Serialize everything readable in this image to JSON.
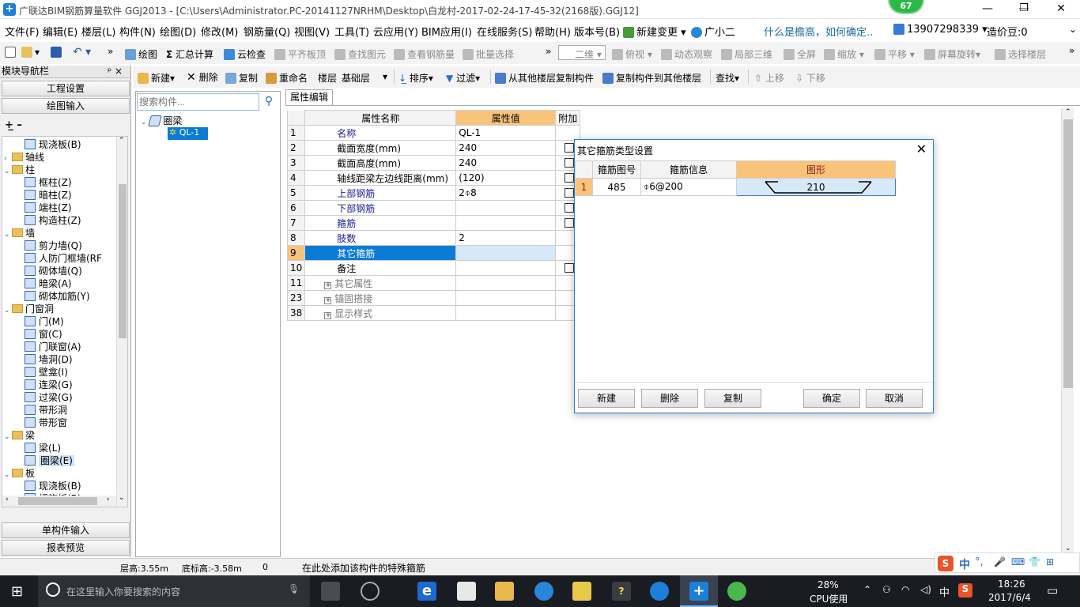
{
  "window": {
    "title": "广联达BIM钢筋算量软件 GGJ2013 - [C:\\Users\\Administrator.PC-20141127NRHM\\Desktop\\白龙村-2017-02-24-17-45-32(2168版).GGJ12]",
    "badge": "67",
    "minimize": "—",
    "maximize": "❐",
    "close": "✕"
  },
  "menu": [
    "文件(F)",
    "编辑(E)",
    "楼层(L)",
    "构件(N)",
    "绘图(D)",
    "修改(M)",
    "钢筋量(Q)",
    "视图(V)",
    "工具(T)",
    "云应用(Y)",
    "BIM应用(I)",
    "在线服务(S)",
    "帮助(H)",
    "版本号(B)",
    "新建变更 ▾",
    "广小二",
    "什么是檐高，如何确定..",
    "13907298339 ▾",
    "造价豆:0"
  ],
  "toolbar1": {
    "draw": "绘图",
    "sum": "汇总计算",
    "cloud_check": "云检查",
    "flush": "平齐板顶",
    "find": "查找图元",
    "view_rebar": "查看钢筋量",
    "batch": "批量选择",
    "view_mode": "二维",
    "top_view": "俯视",
    "dynamic": "动态观察",
    "local3d": "局部三维",
    "fullscreen": "全屏",
    "zoom": "缩放",
    "pan": "平移",
    "rotate": "屏幕旋转",
    "select_floor": "选择楼层"
  },
  "toolbar2": {
    "new": "新建",
    "delete": "删除",
    "copy": "复制",
    "rename": "重命名",
    "floor_label": "楼层",
    "floor_value": "基础层",
    "sort": "排序",
    "filter": "过滤",
    "copy_from": "从其他楼层复制构件",
    "copy_to": "复制构件到其他楼层",
    "find": "查找",
    "up": "上移",
    "down": "下移"
  },
  "nav": {
    "title": "模块导航栏",
    "pin": "ᵖ ×",
    "project_settings": "工程设置",
    "drawing_input": "绘图输入",
    "single_input": "单构件输入",
    "report": "报表预览",
    "items": [
      {
        "label": "现浇板(B)",
        "type": "c"
      },
      {
        "label": "轴线",
        "type": "f",
        "exp": "›"
      },
      {
        "label": "柱",
        "type": "f",
        "exp": "⌄"
      },
      {
        "label": "框柱(Z)",
        "type": "c"
      },
      {
        "label": "暗柱(Z)",
        "type": "c"
      },
      {
        "label": "端柱(Z)",
        "type": "c"
      },
      {
        "label": "构造柱(Z)",
        "type": "c"
      },
      {
        "label": "墙",
        "type": "f",
        "exp": "⌄"
      },
      {
        "label": "剪力墙(Q)",
        "type": "c"
      },
      {
        "label": "人防门框墙(RF",
        "type": "c"
      },
      {
        "label": "砌体墙(Q)",
        "type": "c"
      },
      {
        "label": "暗梁(A)",
        "type": "c"
      },
      {
        "label": "砌体加筋(Y)",
        "type": "c"
      },
      {
        "label": "门窗洞",
        "type": "f",
        "exp": "⌄"
      },
      {
        "label": "门(M)",
        "type": "c"
      },
      {
        "label": "窗(C)",
        "type": "c"
      },
      {
        "label": "门联窗(A)",
        "type": "c"
      },
      {
        "label": "墙洞(D)",
        "type": "c"
      },
      {
        "label": "壁龛(I)",
        "type": "c"
      },
      {
        "label": "连梁(G)",
        "type": "c"
      },
      {
        "label": "过梁(G)",
        "type": "c"
      },
      {
        "label": "带形洞",
        "type": "c"
      },
      {
        "label": "带形窗",
        "type": "c"
      },
      {
        "label": "梁",
        "type": "f",
        "exp": "⌄"
      },
      {
        "label": "梁(L)",
        "type": "c"
      },
      {
        "label": "圈梁(E)",
        "type": "c",
        "sel": true
      },
      {
        "label": "板",
        "type": "f",
        "exp": "⌄"
      },
      {
        "label": "现浇板(B)",
        "type": "c"
      },
      {
        "label": "螺旋板(B)",
        "type": "c"
      }
    ]
  },
  "component": {
    "search_placeholder": "搜索构件...",
    "root": "圈梁",
    "child": "QL-1"
  },
  "props": {
    "tab": "属性编辑",
    "headers": [
      "属性名称",
      "属性值",
      "附加"
    ],
    "rows": [
      {
        "n": "1",
        "name": "名称",
        "value": "QL-1",
        "blue": true,
        "cb": false
      },
      {
        "n": "2",
        "name": "截面宽度(mm)",
        "value": "240",
        "blue": false,
        "cb": true
      },
      {
        "n": "3",
        "name": "截面高度(mm)",
        "value": "240",
        "blue": false,
        "cb": true
      },
      {
        "n": "4",
        "name": "轴线距梁左边线距离(mm)",
        "value": "(120)",
        "blue": false,
        "cb": true
      },
      {
        "n": "5",
        "name": "上部钢筋",
        "value": "2⌽8",
        "blue": true,
        "cb": true
      },
      {
        "n": "6",
        "name": "下部钢筋",
        "value": "",
        "blue": true,
        "cb": true
      },
      {
        "n": "7",
        "name": "箍筋",
        "value": "",
        "blue": true,
        "cb": true
      },
      {
        "n": "8",
        "name": "肢数",
        "value": "2",
        "blue": true,
        "cb": false
      },
      {
        "n": "9",
        "name": "其它箍筋",
        "value": "",
        "blue": false,
        "cb": false,
        "sel": true
      },
      {
        "n": "10",
        "name": "备注",
        "value": "",
        "blue": false,
        "cb": true
      },
      {
        "n": "11",
        "name": "其它属性",
        "value": "",
        "blue": false,
        "cb": false,
        "group": true
      },
      {
        "n": "23",
        "name": "锚固搭接",
        "value": "",
        "blue": false,
        "cb": false,
        "group": true
      },
      {
        "n": "38",
        "name": "显示样式",
        "value": "",
        "blue": false,
        "cb": false,
        "group": true
      }
    ]
  },
  "dialog": {
    "title": "其它箍筋类型设置",
    "headers": [
      "箍筋图号",
      "箍筋信息",
      "图形"
    ],
    "row": {
      "n": "1",
      "code": "485",
      "info": "⌽6@200",
      "shape_value": "210"
    },
    "buttons": {
      "new": "新建",
      "delete": "删除",
      "copy": "复制",
      "ok": "确定",
      "cancel": "取消"
    }
  },
  "status": {
    "floor_height": "层高:3.55m",
    "base_height": "底标高:-3.58m",
    "count": "0",
    "hint": "在此处添加该构件的特殊箍筋"
  },
  "taskbar": {
    "search_placeholder": "在这里输入你要搜索的内容",
    "cpu_percent": "28%",
    "cpu_label": "CPU使用",
    "ime": "中",
    "time": "18:26",
    "date": "2017/6/4"
  },
  "ime_bar": [
    "中",
    "°,",
    "🎤",
    "⌨",
    "👕",
    "⊞"
  ],
  "colors": {
    "accent": "#0078d7",
    "header_orange": "#f9c47a",
    "selected_row": "#0b7bd6"
  }
}
